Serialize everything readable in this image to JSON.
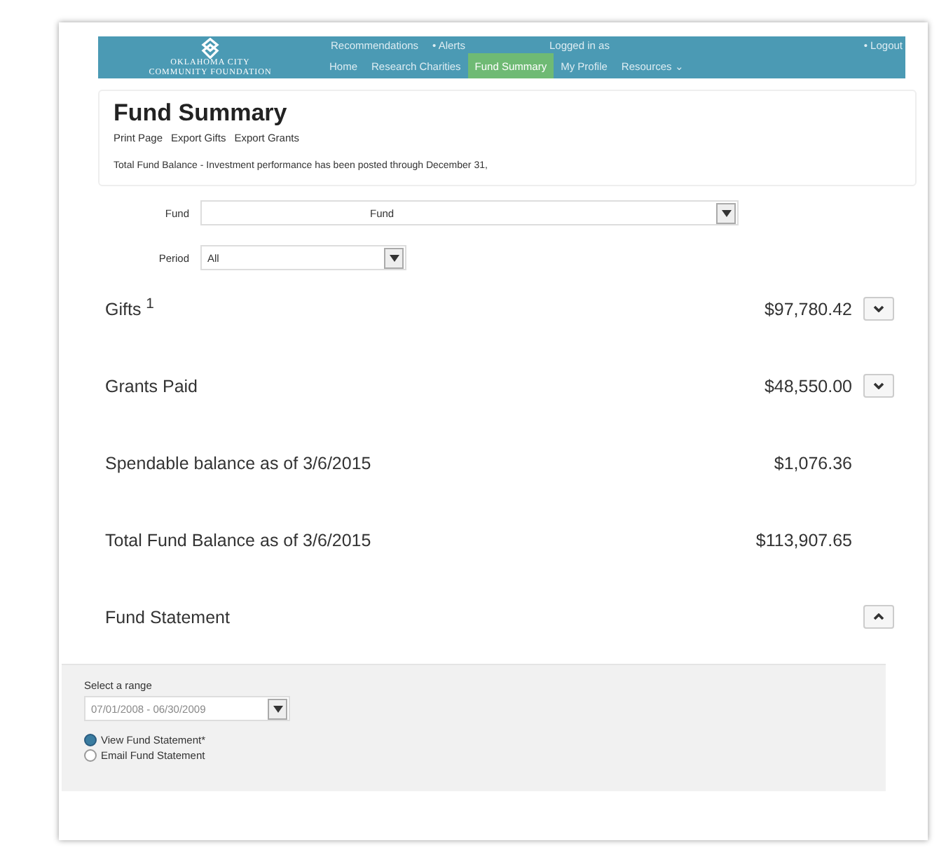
{
  "header": {
    "logo_lines": [
      "OKLAHOMA CITY",
      "COMMUNITY FOUNDATION"
    ],
    "top_links": [
      "Recommendations",
      "• Alerts"
    ],
    "user": {
      "label": "Logged in as"
    },
    "logout": {
      "label": "• Logout"
    },
    "nav": [
      {
        "label": "Home",
        "selected": false
      },
      {
        "label": "Research Charities",
        "selected": false
      },
      {
        "label": "Fund Summary",
        "selected": true
      },
      {
        "label": "My Profile",
        "selected": false
      },
      {
        "label": "Resources",
        "selected": false,
        "caret": "⌄"
      }
    ]
  },
  "page": {
    "title": "Fund Summary",
    "actions": [
      "Print Page",
      "Export Gifts",
      "Export Grants"
    ],
    "notice": "Total Fund Balance - Investment performance has been posted through December 31,"
  },
  "filters": [
    {
      "label": "Fund",
      "value": "Fund",
      "kind": "fund"
    },
    {
      "label": "Period",
      "value": "All",
      "kind": "period"
    }
  ],
  "summary": [
    {
      "label": "Gifts $^{1}$",
      "amount": "$97,780.42",
      "expanded": false
    },
    {
      "label": "Grants Paid",
      "amount": "$48,550.00",
      "expanded": false
    },
    {
      "label": "Spendable balance as of 3/6/2015",
      "amount": "$1,076.36"
    },
    {
      "label": "Total Fund Balance as of 3/6/2015",
      "amount": "$113,907.65"
    },
    {
      "label": "Fund Statement",
      "expanded": true
    }
  ],
  "statement": {
    "range_label": "Select a range",
    "range_value": "07/01/2008 - 06/30/2009",
    "options": [
      {
        "label": "View Fund Statement*",
        "selected": true
      },
      {
        "label": "Email Fund Statement",
        "selected": false
      }
    ]
  }
}
